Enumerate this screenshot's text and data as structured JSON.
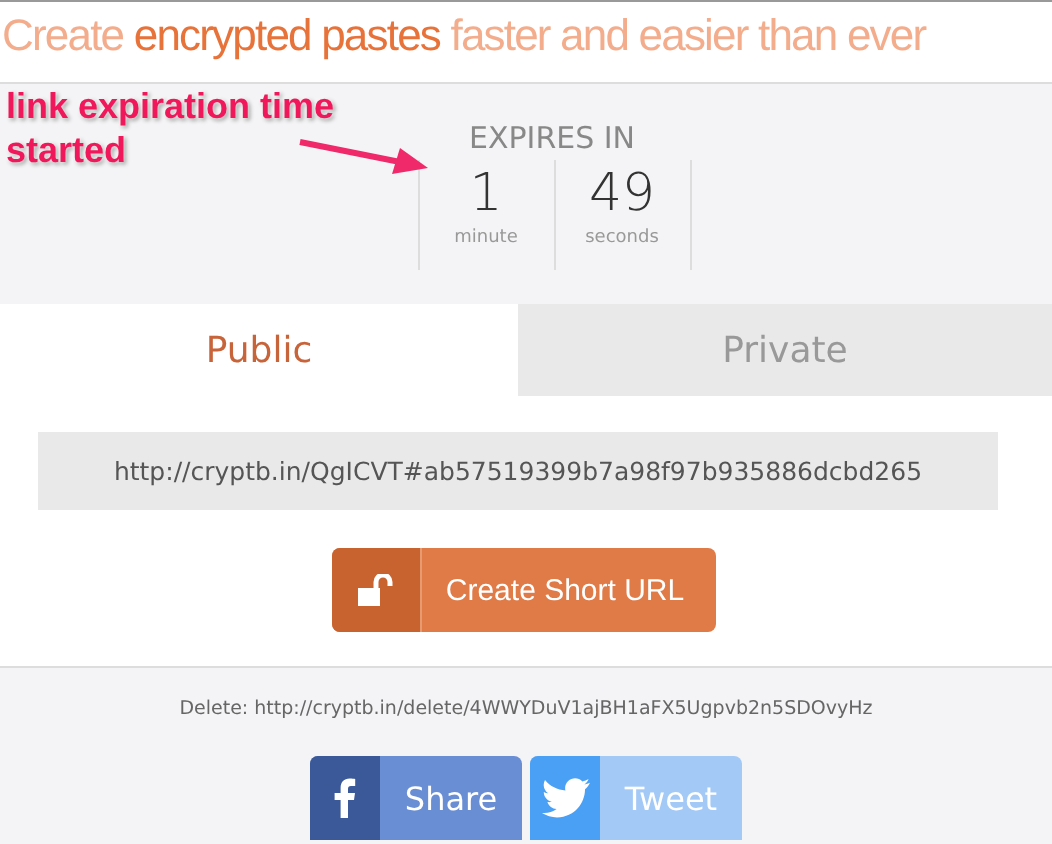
{
  "headline": "Create **encrypted pastes** faster and easier than ever",
  "annotation": {
    "text": "link expiration time started"
  },
  "expiry": {
    "title": "EXPIRES IN",
    "units": [
      {
        "value": "1",
        "unit": "minute"
      },
      {
        "value": "49",
        "unit": "seconds"
      }
    ]
  },
  "tabs": [
    {
      "label": "Public",
      "selected": true
    },
    {
      "label": "Private",
      "selected": false
    }
  ],
  "url_field": {
    "value": "http://cryptb.in/QgICVT#ab57519399b7a98f97b935886dcbd265"
  },
  "create_button": {
    "label": "Create Short URL"
  },
  "delete_link": "Delete: http://cryptb.in/delete/4WWYDuV1ajBH1aFX5Ugpvb2n5SDOvyHz",
  "share_buttons": [
    {
      "kind": "facebook",
      "label": "Share"
    },
    {
      "kind": "twitter",
      "label": "Tweet"
    }
  ]
}
